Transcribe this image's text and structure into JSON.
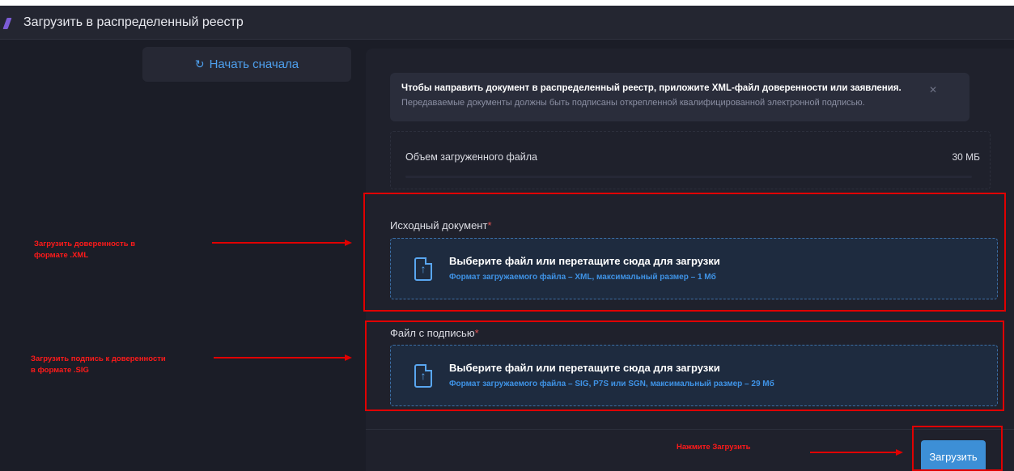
{
  "window": {
    "title": "Загрузить в распределенный реестр"
  },
  "restart_button": {
    "label": "Начать сначала",
    "icon": "refresh-icon"
  },
  "notice": {
    "line1": "Чтобы направить документ в распределенный реестр, приложите XML-файл доверенности или заявления.",
    "line2": "Передаваемые документы должны быть подписаны открепленной квалифицированной электронной подписью.",
    "close_glyph": "✕"
  },
  "filesize": {
    "label": "Объем загруженного файла",
    "value": "30 МБ"
  },
  "source_document": {
    "label": "Исходный документ",
    "required_mark": "*",
    "dropzone_title": "Выберите файл или перетащите сюда для загрузки",
    "dropzone_hint": "Формат загружаемого файла – XML, максимальный размер – 1 Мб"
  },
  "signature_file": {
    "label": "Файл с подписью",
    "required_mark": "*",
    "dropzone_title": "Выберите файл или перетащите сюда для загрузки",
    "dropzone_hint": "Формат загружаемого файла – SIG, P7S или SGN, максимальный размер – 29 Мб"
  },
  "upload_button": {
    "label": "Загрузить"
  },
  "annotations": {
    "upload_xml_line1": "Загрузить доверенность в",
    "upload_xml_line2": "формате .XML",
    "upload_sig_line1": "Загрузить подпись к доверенности",
    "upload_sig_line2": "в формате .SIG",
    "press_upload": "Нажмите Загрузить"
  },
  "colors": {
    "background": "#1b1d27",
    "accent": "#3d8fd6",
    "annotation": "#e00000"
  }
}
